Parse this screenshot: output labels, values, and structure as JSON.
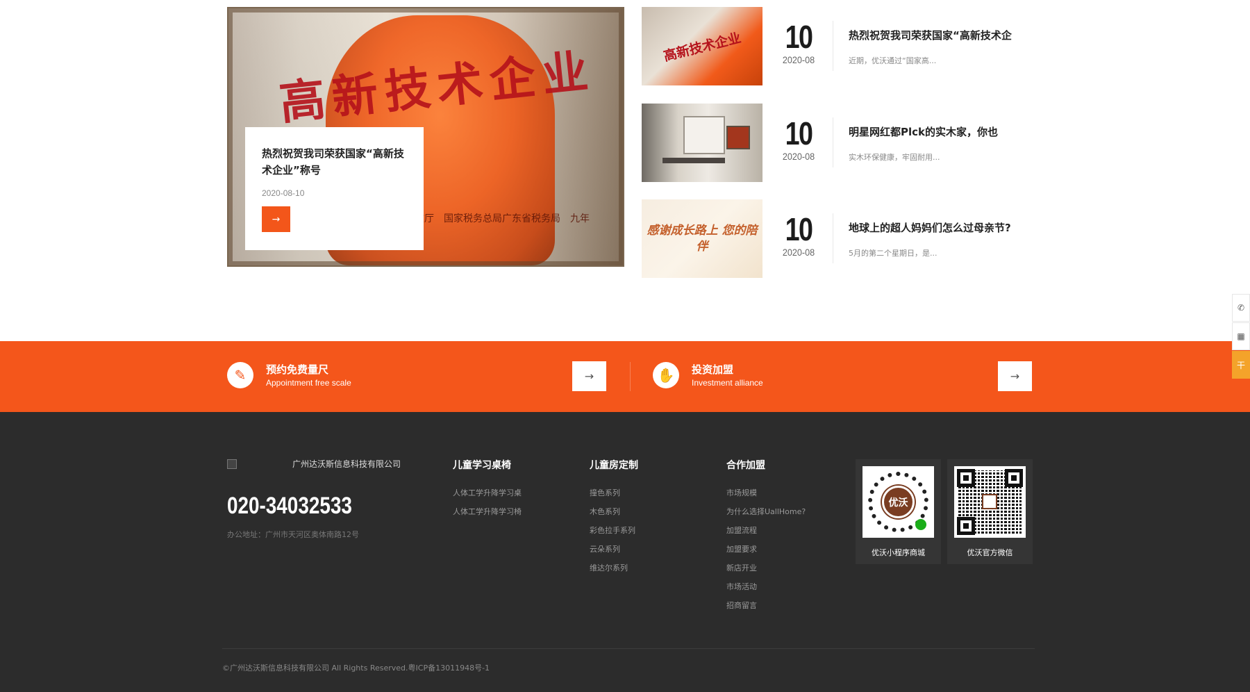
{
  "news": {
    "feature": {
      "image_text": "高新技术企业",
      "image_subtext": "政厅　国家税务总局广东省税务局　九年",
      "title": "热烈祝贺我司荣获国家“高新技术企业”称号",
      "date": "2020-08-10",
      "arrow": "→"
    },
    "items": [
      {
        "thumb_text": "高新技术企业",
        "day": "10",
        "month": "2020-08",
        "title": "热烈祝贺我司荣获国家“高新技术企",
        "summary": "近期，优沃通过“国家高..."
      },
      {
        "thumb_text": "",
        "day": "10",
        "month": "2020-08",
        "title": "明星网红都Plck的实木家，你也",
        "summary": "实木环保健康，牢固耐用..."
      },
      {
        "thumb_text": "感谢成长路上 您的陪伴",
        "day": "10",
        "month": "2020-08",
        "title": "地球上的超人妈妈们怎么过母亲节?",
        "summary": "5月的第二个星期日，是..."
      }
    ]
  },
  "cta": {
    "left": {
      "icon": "✎",
      "title": "预约免费量尺",
      "subtitle": "Appointment free scale",
      "arrow": "→"
    },
    "right": {
      "icon": "✋",
      "title": "投资加盟",
      "subtitle": "Investment alliance",
      "arrow": "→"
    }
  },
  "footer": {
    "company": "广州达沃斯信息科技有限公司",
    "phone": "020-34032533",
    "address": "办公地址：广州市天河区奥体南路12号",
    "columns": [
      {
        "head": "儿童学习桌椅",
        "links": [
          "人体工学升降学习桌",
          "人体工学升降学习椅"
        ]
      },
      {
        "head": "儿童房定制",
        "links": [
          "撞色系列",
          "木色系列",
          "彩色拉手系列",
          "云朵系列",
          "维达尔系列"
        ]
      },
      {
        "head": "合作加盟",
        "links": [
          "市场规模",
          "为什么选择UallHome?",
          "加盟流程",
          "加盟要求",
          "新店开业",
          "市场活动",
          "招商留言"
        ]
      }
    ],
    "qr": [
      {
        "label": "优沃小程序商城",
        "center_text": "优沃"
      },
      {
        "label": "优沃官方微信"
      }
    ],
    "copyright": "©广州达沃斯信息科技有限公司 All Rights Reserved.粤ICP备13011948号-1"
  },
  "side_tools": {
    "phone_icon": "✆",
    "qr_icon": "▦",
    "top_icon": "干"
  },
  "colors": {
    "accent": "#f4561b",
    "footer_bg": "#2c2c2c",
    "side_highlight": "#f4a32a"
  }
}
